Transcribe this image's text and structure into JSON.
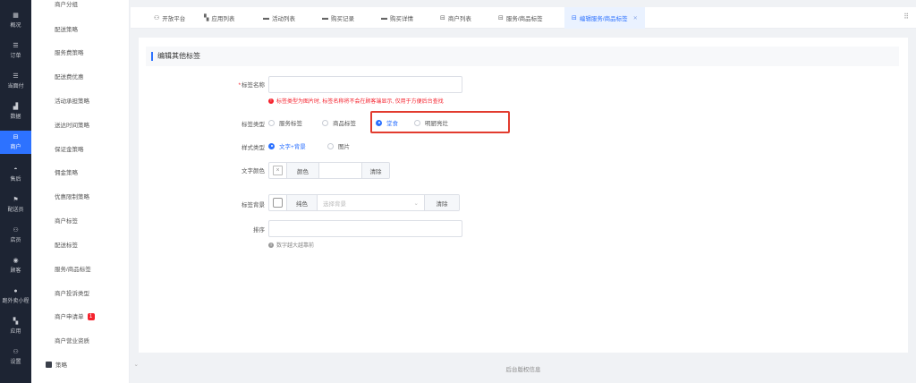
{
  "rail": [
    {
      "label": "概况",
      "icon": "▦"
    },
    {
      "label": "订单",
      "icon": "☰"
    },
    {
      "label": "当面付",
      "icon": "☰"
    },
    {
      "label": "数据",
      "icon": "▟"
    },
    {
      "label": "商户",
      "icon": "⊟"
    },
    {
      "label": "售后",
      "icon": "◓"
    },
    {
      "label": "配送员",
      "icon": "⚑"
    },
    {
      "label": "店员",
      "icon": "⚇"
    },
    {
      "label": "顾客",
      "icon": "◉"
    },
    {
      "label": "跑外卖小程",
      "icon": "●"
    },
    {
      "label": "应用",
      "icon": "▚"
    },
    {
      "label": "设置",
      "icon": "⚇"
    }
  ],
  "submenu": {
    "items": [
      "商户分组",
      "配送策略",
      "服务费策略",
      "配送费优惠",
      "活动承担策略",
      "送达时间策略",
      "保证金策略",
      "佣金策略",
      "优惠限制策略",
      "商户标签",
      "配送标签",
      "服务/商品标签",
      "商户投诉类型",
      "商户申请单",
      "商户营业资质"
    ],
    "badge": "1",
    "group": "策略"
  },
  "tabs": [
    {
      "label": "开放平台",
      "icon": "⚇"
    },
    {
      "label": "应用列表",
      "icon": "▚"
    },
    {
      "label": "活动列表",
      "icon": "▬"
    },
    {
      "label": "购买记录",
      "icon": "▬"
    },
    {
      "label": "购买详情",
      "icon": "▬"
    },
    {
      "label": "商户列表",
      "icon": "⊟"
    },
    {
      "label": "服务/商品标签",
      "icon": "⊟"
    },
    {
      "label": "编辑服务/商品标签",
      "icon": "⊟"
    }
  ],
  "form": {
    "section_title": "编辑其他标签",
    "name_label": "标签名称",
    "name_value": "",
    "name_tip": "标签类型为图片时, 标签名称将不会在顾客端显示, 仅用于方便后台查找",
    "type_label": "标签类型",
    "type_options": [
      "服务标签",
      "商品标签",
      "堂食",
      "明厨亮灶"
    ],
    "type_selected": "堂食",
    "style_label": "样式类型",
    "style_options": [
      "文字+背景",
      "图片"
    ],
    "style_selected": "文字+背景",
    "text_color_label": "文字颜色",
    "text_color_btn": "颜色",
    "text_color_clear": "清除",
    "bg_label": "标签背景",
    "bg_color_btn": "纯色",
    "bg_placeholder": "选择背景",
    "bg_clear": "清除",
    "sort_label": "排序",
    "sort_value": "",
    "sort_tip": "数字越大越靠前"
  },
  "footer": "后台版权信息",
  "colors": {
    "accent": "#2d72ff",
    "highlight": "#e23b2e",
    "rail_bg": "#1d2433"
  }
}
